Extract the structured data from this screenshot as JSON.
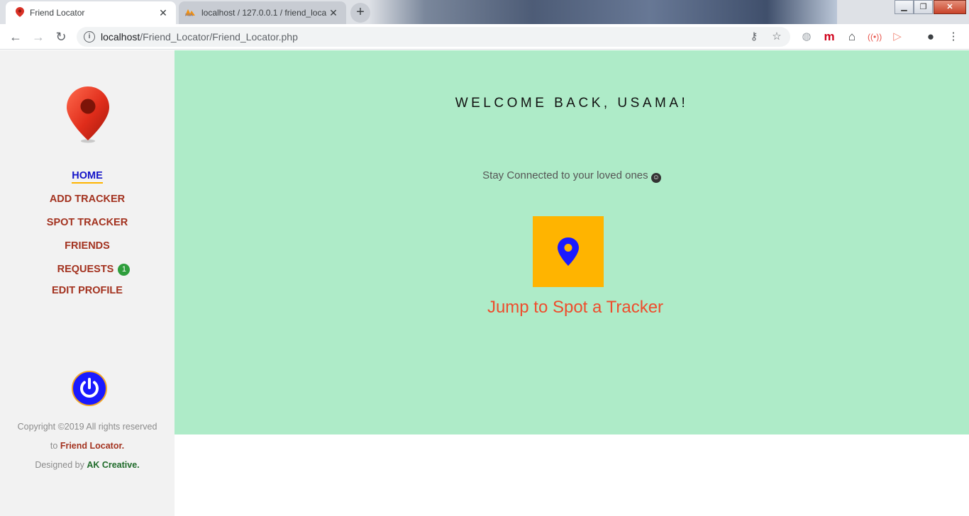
{
  "browser": {
    "tabs": [
      {
        "title": "Friend Locator",
        "active": true
      },
      {
        "title": "localhost / 127.0.0.1 / friend_loca",
        "active": false
      }
    ],
    "url_host": "localhost",
    "url_path": "/Friend_Locator/Friend_Locator.php"
  },
  "sidebar": {
    "nav": [
      {
        "label": "HOME",
        "active": true
      },
      {
        "label": "ADD TRACKER"
      },
      {
        "label": "SPOT TRACKER"
      },
      {
        "label": "FRIENDS"
      },
      {
        "label": "REQUESTS",
        "badge": "1"
      },
      {
        "label": "EDIT PROFILE"
      }
    ],
    "footer": {
      "copyright_prefix": "Copyright ©2019 All rights reserved to",
      "brand": "Friend Locator.",
      "designed_prefix": "Designed by",
      "designer": "AK Creative."
    }
  },
  "main": {
    "welcome": "WELCOME BACK, USAMA!",
    "tagline": "Stay Connected to your loved ones",
    "spot_link": "Jump to Spot a Tracker"
  },
  "colors": {
    "main_bg": "#aeebc8",
    "sidebar_bg": "#f2f2f2",
    "nav_text": "#a3321f",
    "nav_active": "#1414c8",
    "accent": "#ffb400",
    "link": "#ee4d2d",
    "power_button": "#1a1aff"
  }
}
